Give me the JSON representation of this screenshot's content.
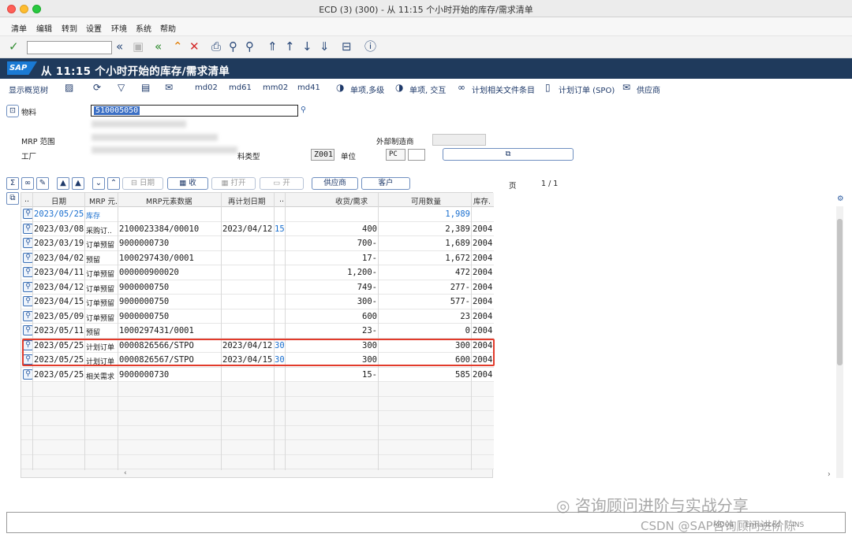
{
  "window": {
    "title": "ECD (3) (300) - 从 11:15 个小时开始的库存/需求清单"
  },
  "menu": [
    "清单",
    "编辑",
    "转到",
    "设置",
    "环境",
    "系统",
    "帮助"
  ],
  "header": {
    "title": "从 11:15 个小时开始的库存/需求清单",
    "logo": "SAP"
  },
  "app_toolbar": {
    "display_overview": "显示概览树",
    "md02": "md02",
    "md61": "md61",
    "mm02": "mm02",
    "md41": "md41",
    "single_multi": "单项,多级",
    "single_interactive": "单项, 交互",
    "planning_file": "计划相关文件条目",
    "planned_order": "计划订单 (SPO)",
    "vendor": "供应商"
  },
  "form": {
    "material_label": "物料",
    "material_value": "510005050",
    "mrp_area_label": "MRP 范围",
    "plant_label": "工厂",
    "material_type_label": "料类型",
    "material_type_value": "Z001",
    "unit_label": "单位",
    "unit_value": "PC",
    "ext_proc_label": "外部制造商"
  },
  "grid_toolbar": {
    "date_btn": "日期",
    "receive_btn": "收",
    "open_btn": "打开",
    "open2_btn": "开",
    "vendor_btn": "供应商",
    "customer_btn": "客户",
    "page_label": "页",
    "page_value": "1 /  1"
  },
  "columns": [
    "..",
    "日期",
    "MRP 元.",
    "MRP元素数据",
    "再计划日期",
    "..",
    "收货/需求",
    "可用数量",
    "库存."
  ],
  "rows": [
    {
      "date": "2023/05/25",
      "type": "库存",
      "data": "",
      "resched": "",
      "ex": "",
      "qty": "",
      "avail": "1,989",
      "stock": "",
      "blue": true
    },
    {
      "date": "2023/03/08",
      "type": "采购订..",
      "data": "2100023384/00010",
      "resched": "2023/04/12",
      "ex": "15",
      "qty": "400",
      "avail": "2,389",
      "stock": "2004"
    },
    {
      "date": "2023/03/19",
      "type": "订单预留",
      "data": "9000000730",
      "resched": "",
      "ex": "",
      "qty": "700-",
      "avail": "1,689",
      "stock": "2004"
    },
    {
      "date": "2023/04/02",
      "type": "预留",
      "data": "1000297430/0001",
      "resched": "",
      "ex": "",
      "qty": "17-",
      "avail": "1,672",
      "stock": "2004"
    },
    {
      "date": "2023/04/11",
      "type": "订单预留",
      "data": "000000900020",
      "resched": "",
      "ex": "",
      "qty": "1,200-",
      "avail": "472",
      "stock": "2004"
    },
    {
      "date": "2023/04/12",
      "type": "订单预留",
      "data": "9000000750",
      "resched": "",
      "ex": "",
      "qty": "749-",
      "avail": "277-",
      "stock": "2004"
    },
    {
      "date": "2023/04/15",
      "type": "订单预留",
      "data": "9000000750",
      "resched": "",
      "ex": "",
      "qty": "300-",
      "avail": "577-",
      "stock": "2004"
    },
    {
      "date": "2023/05/09",
      "type": "订单预留",
      "data": "9000000750",
      "resched": "",
      "ex": "",
      "qty": "600",
      "avail": "23",
      "stock": "2004"
    },
    {
      "date": "2023/05/11",
      "type": "预留",
      "data": "1000297431/0001",
      "resched": "",
      "ex": "",
      "qty": "23-",
      "avail": "0",
      "stock": "2004"
    },
    {
      "date": "2023/05/25",
      "type": "计划订单",
      "data": "0000826566/STPO",
      "resched": "2023/04/12",
      "ex": "30",
      "qty": "300",
      "avail": "300",
      "stock": "2004"
    },
    {
      "date": "2023/05/25",
      "type": "计划订单",
      "data": "0000826567/STPO",
      "resched": "2023/04/15",
      "ex": "30",
      "qty": "300",
      "avail": "600",
      "stock": "2004"
    },
    {
      "date": "2023/05/25",
      "type": "相关需求",
      "data": "9000000730",
      "resched": "",
      "ex": "",
      "qty": "15-",
      "avail": "585",
      "stock": "2004"
    }
  ],
  "status": {
    "text": "MD04 ｜ Enhanced ｜ INS"
  },
  "watermark": {
    "line1": "咨询顾问进阶与实战分享",
    "line2": "CSDN @SAP咨询顾问进阶陈"
  },
  "colors": {
    "header_bg": "#1f3a5c",
    "highlight": "#e23b2b",
    "link": "#1a6fcf"
  }
}
